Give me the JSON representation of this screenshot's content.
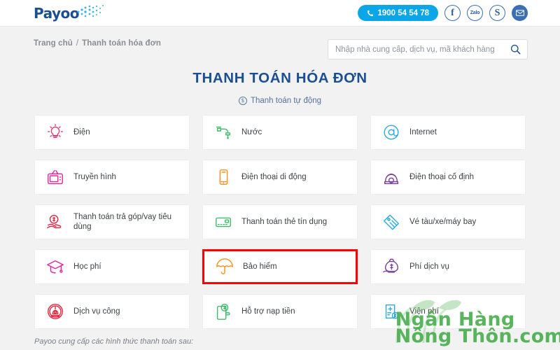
{
  "header": {
    "logo_text": "Payoo",
    "logo_icon": "dot-spray-icon",
    "phone_label": "1900 54 54 78",
    "phone_icon": "phone-icon",
    "social": [
      {
        "name": "facebook",
        "label": "f",
        "icon": "facebook-icon"
      },
      {
        "name": "zalo",
        "label": "Zalo",
        "icon": "zalo-icon"
      },
      {
        "name": "skype",
        "label": "S",
        "icon": "skype-icon"
      },
      {
        "name": "email",
        "label": "",
        "icon": "envelope-icon"
      }
    ]
  },
  "breadcrumb": {
    "home": "Trang chủ",
    "separator": "/",
    "current": "Thanh toán hóa đơn"
  },
  "search": {
    "placeholder": "Nhập nhà cung cấp, dịch vụ, mã khách hàng",
    "value": "",
    "icon": "search-icon"
  },
  "main": {
    "title": "THANH TOÁN HÓA ĐƠN",
    "subtitle": "Thanh toán tự động",
    "subtitle_icon": "circled-dollar-icon",
    "footer_note": "Payoo cung cấp các hình thức thanh toán sau:"
  },
  "colors": {
    "brand_blue": "#1c4f91",
    "accent_cyan": "#0aa6e8",
    "highlight_red": "#ff0000",
    "page_bg": "#f2f2f2",
    "card_bg": "#ffffff",
    "watermark_green": "#4caf50"
  },
  "services": [
    {
      "label": "Điện",
      "icon": "lightbulb-icon",
      "color": "#e8376f",
      "highlighted": false
    },
    {
      "label": "Nước",
      "icon": "faucet-icon",
      "color": "#3fba6a",
      "highlighted": false
    },
    {
      "label": "Internet",
      "icon": "at-sign-icon",
      "color": "#29abe2",
      "highlighted": false
    },
    {
      "label": "Truyền hình",
      "icon": "television-icon",
      "color": "#e8249b",
      "highlighted": false
    },
    {
      "label": "Điện thoại di động",
      "icon": "smartphone-icon",
      "color": "#f5911e",
      "highlighted": false
    },
    {
      "label": "Điện thoại cố định",
      "icon": "landline-icon",
      "color": "#7b3fa0",
      "highlighted": false
    },
    {
      "label": "Thanh toán trả góp/vay tiêu dùng",
      "icon": "hand-coin-icon",
      "color": "#e8243c",
      "highlighted": false
    },
    {
      "label": "Thanh toán thẻ tín dụng",
      "icon": "credit-card-icon",
      "color": "#3fba6a",
      "highlighted": false
    },
    {
      "label": "Vé tàu/xe/máy bay",
      "icon": "ticket-icon",
      "color": "#29abe2",
      "highlighted": false
    },
    {
      "label": "Học phí",
      "icon": "graduation-cap-icon",
      "color": "#e8249b",
      "highlighted": false
    },
    {
      "label": "Bảo hiểm",
      "icon": "umbrella-icon",
      "color": "#f5911e",
      "highlighted": true
    },
    {
      "label": "Phí dịch vụ",
      "icon": "money-bag-icon",
      "color": "#7b3fa0",
      "highlighted": false
    },
    {
      "label": "Dịch vụ công",
      "icon": "government-emblem-icon",
      "color": "#e8243c",
      "highlighted": false
    },
    {
      "label": "Hỗ trợ nạp tiền",
      "icon": "wallet-topup-icon",
      "color": "#3fba6a",
      "highlighted": false
    },
    {
      "label": "Viện phí",
      "icon": "medical-bill-icon",
      "color": "#29abe2",
      "highlighted": false
    }
  ],
  "watermark": {
    "line1": "Ngân Hàng",
    "line2": "Nông Thôn.com",
    "icon": "sprout-icon"
  }
}
